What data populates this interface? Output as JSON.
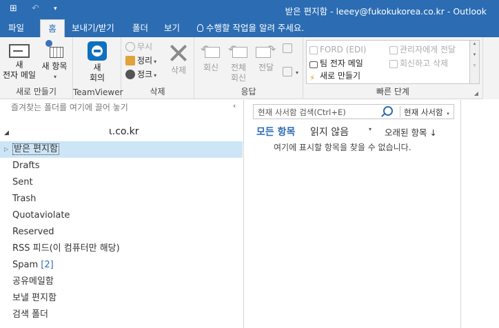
{
  "window": {
    "title": "받은 편지함 - leeey@fukokukorea.co.kr - Outlook"
  },
  "tabs": [
    {
      "label": "파일"
    },
    {
      "label": "홈"
    },
    {
      "label": "보내기/받기"
    },
    {
      "label": "폴더"
    },
    {
      "label": "보기"
    }
  ],
  "tell_me": "수행할 작업을 알려 주세요.",
  "ribbon": {
    "new_group": {
      "label": "새로 만들기",
      "new_mail": [
        "새",
        "전자 메일"
      ],
      "new_items": [
        "새 항목"
      ]
    },
    "teamviewer_group": {
      "label": "TeamViewer",
      "new_meeting": [
        "새",
        "회의"
      ]
    },
    "delete_group": {
      "label": "삭제",
      "ignore": "무시",
      "cleanup": "정리",
      "junk": "정크",
      "delete": "삭제"
    },
    "respond_group": {
      "label": "응답",
      "reply": "회신",
      "reply_all": [
        "전체",
        "회신"
      ],
      "forward": "전달"
    },
    "quick_steps_group": {
      "label": "빠른 단계",
      "items": [
        {
          "label": "FORD (EDI)",
          "enabled": false
        },
        {
          "label": "관리자에게 전달",
          "enabled": false
        },
        {
          "label": "팀 전자 메일",
          "enabled": true
        },
        {
          "label": "회신하고 삭제",
          "enabled": false
        },
        {
          "label": "새로 만들기",
          "enabled": true
        }
      ]
    }
  },
  "folder_pane": {
    "favorites_hint": "즐겨찾는 폴더를 여기에 끌어 놓기",
    "account": "ι.co.kr",
    "folders": [
      {
        "name": "받은 편지함",
        "count": "",
        "selected": true
      },
      {
        "name": "Drafts",
        "count": ""
      },
      {
        "name": "Sent",
        "count": ""
      },
      {
        "name": "Trash",
        "count": ""
      },
      {
        "name": "Quotaviolate",
        "count": ""
      },
      {
        "name": "Reserved",
        "count": ""
      },
      {
        "name": "RSS 피드(이 컴퓨터만 해당)",
        "count": ""
      },
      {
        "name": "Spam",
        "count": "[2]"
      },
      {
        "name": "공유메일함",
        "count": ""
      },
      {
        "name": "보낼 편지함",
        "count": ""
      },
      {
        "name": "검색 폴더",
        "count": ""
      }
    ]
  },
  "message_list": {
    "search_placeholder": "현재 사서함 검색(Ctrl+E)",
    "search_scope": "현재 사서함",
    "filter_all": "모든 항목",
    "filter_unread": "읽지 않음",
    "sort": "오래된 항목 ↓",
    "empty_message": "여기에 표시할 항목을 찾을 수 없습니다."
  },
  "colors": {
    "accent": "#2b6cb3",
    "selected_folder": "#cde6f7",
    "ribbon_bg": "#f3f3f3"
  }
}
